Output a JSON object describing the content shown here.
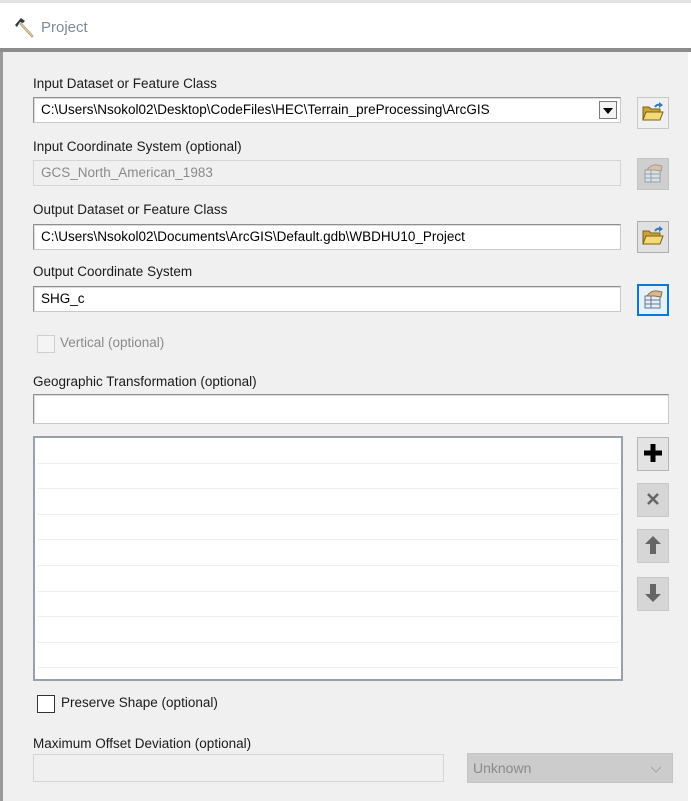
{
  "window": {
    "title": "Project",
    "icon": "hammer-icon"
  },
  "form": {
    "input_dataset": {
      "label": "Input Dataset or Feature Class",
      "value": "C:\\Users\\Nsokol02\\Desktop\\CodeFiles\\HEC\\Terrain_preProcessing\\ArcGIS",
      "browse_icon": "open-folder-icon"
    },
    "input_coord": {
      "label": "Input Coordinate System (optional)",
      "value": "GCS_North_American_1983",
      "button_icon": "spatial-reference-icon",
      "disabled": true
    },
    "output_dataset": {
      "label": "Output Dataset or Feature Class",
      "value": "C:\\Users\\Nsokol02\\Documents\\ArcGIS\\Default.gdb\\WBDHU10_Project",
      "browse_icon": "open-folder-icon"
    },
    "output_coord": {
      "label": "Output Coordinate System",
      "value": "SHG_c",
      "button_icon": "spatial-reference-icon"
    },
    "vertical": {
      "label": "Vertical (optional)",
      "checked": false,
      "disabled": true
    },
    "geo_transform": {
      "label": "Geographic Transformation (optional)",
      "value": "",
      "list_items": [
        "",
        "",
        "",
        "",
        "",
        "",
        "",
        "",
        "",
        ""
      ],
      "buttons": [
        {
          "name": "add",
          "icon": "plus-icon",
          "disabled": false
        },
        {
          "name": "remove",
          "icon": "close-icon",
          "disabled": true
        },
        {
          "name": "move-up",
          "icon": "arrow-up-icon",
          "disabled": true
        },
        {
          "name": "move-down",
          "icon": "arrow-down-icon",
          "disabled": true
        }
      ]
    },
    "preserve_shape": {
      "label": "Preserve Shape (optional)",
      "checked": false
    },
    "max_offset": {
      "label": "Maximum Offset Deviation (optional)",
      "value": "",
      "unit": "Unknown",
      "disabled": true
    }
  },
  "colors": {
    "focus_border": "#0a78d7",
    "panel_bg": "#f0f0f0",
    "disabled_text": "#8a8a8a"
  }
}
